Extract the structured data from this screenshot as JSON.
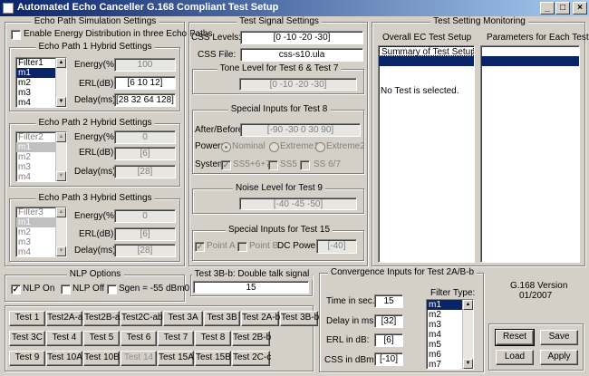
{
  "window": {
    "title": "Automated  Echo Canceller G.168 Compliant Test Setup",
    "minimize": "_",
    "maximize": "□",
    "close": "×"
  },
  "echo_sim": {
    "label": "Echo Path Simulation Settings",
    "enable_energy": "Enable Energy Distribution in three Echo Paths",
    "paths": [
      {
        "label": "Echo Path 1 Hybrid Settings",
        "list": [
          "Filter1",
          "m1",
          "m2",
          "m3",
          "m4"
        ],
        "energy_label": "Energy(%):",
        "energy": "100",
        "erl_label": "ERL(dB):",
        "erl": "[6 10 12]",
        "delay_label": "Delay(ms):",
        "delay": "[28 32 64 128]"
      },
      {
        "label": "Echo Path 2 Hybrid Settings",
        "list": [
          "Filter2",
          "m1",
          "m2",
          "m3",
          "m4"
        ],
        "energy_label": "Energy(%):",
        "energy": "0",
        "erl_label": "ERL(dB):",
        "erl": "[6]",
        "delay_label": "Delay(ms):",
        "delay": "[28]"
      },
      {
        "label": "Echo Path 3 Hybrid Settings",
        "list": [
          "Filter3",
          "m1",
          "m2",
          "m3",
          "m4"
        ],
        "energy_label": "Energy(%):",
        "energy": "0",
        "erl_label": "ERL(dB):",
        "erl": "[6]",
        "delay_label": "Delay(ms):",
        "delay": "[28]"
      }
    ]
  },
  "signal": {
    "label": "Test Signal Settings",
    "css_levels_label": "CSS Levels:",
    "css_levels": "[0 -10 -20 -30]",
    "css_file_label": "CSS File:",
    "css_file": "css-s10.ula",
    "tone_label": "Tone Level for Test 6 & Test 7",
    "tone": "[0 -10 -20 -30]",
    "special8_label": "Special Inputs for Test 8",
    "after_before_label": "After/Before:",
    "after_before": "[-90 -30 0 30 90]",
    "power_label": "Power:",
    "power_options": [
      "Nominal",
      "Extreme1",
      "Extreme2"
    ],
    "system_label": "System:",
    "system_options": [
      "SS5+6+7",
      "SS5",
      "SS 6/7"
    ],
    "noise_label": "Noise Level for Test 9",
    "noise": "[-40 -45 -50]",
    "special15_label": "Special Inputs for Test 15",
    "point_a": "Point A",
    "point_b": "Point B",
    "dc_power_label": "DC Power:",
    "dc_power": "[-40]"
  },
  "monitor": {
    "label": "Test Setting Monitoring",
    "overall_label": "Overall EC Test Setup",
    "params_label": "Parameters for Each Test",
    "overall_items": [
      "Summary of Test Setup"
    ],
    "no_test": "No Test is selected."
  },
  "nlp": {
    "label": "NLP Options",
    "on": "NLP On",
    "off": "NLP Off",
    "sgen": "Sgen = -55 dBm0"
  },
  "test3b": {
    "label": "Test 3B-b: Double talk signal",
    "value": "15"
  },
  "tests": [
    [
      "Test 1",
      "Test2A-a",
      "Test2B-a",
      "Test2C-ab",
      "Test 3A",
      "Test 3B",
      "Test 2A-b",
      "Test 3B-b"
    ],
    [
      "Test 3C",
      "Test 4",
      "Test 5",
      "Test 6",
      "Test 7",
      "Test 8",
      "Test 2B-b"
    ],
    [
      "Test 9",
      "Test 10A",
      "Test 10B",
      "Test 14",
      "Test 15A",
      "Test 15B",
      "Test 2C-c"
    ]
  ],
  "convergence": {
    "label": "Convergence Inputs for Test 2A/B-b",
    "time_label": "Time in sec.",
    "time": "15",
    "delay_label": "Delay in ms:",
    "delay": "[32]",
    "erl_label": "ERL in dB:",
    "erl": "[6]",
    "css_label": "CSS in dBm0:",
    "css": "[-10]",
    "filter_label": "Filter Type:",
    "filters": [
      "m1",
      "m2",
      "m3",
      "m4",
      "m5",
      "m6",
      "m7"
    ]
  },
  "version": {
    "line1": "G.168 Version",
    "line2": "01/2007"
  },
  "actions": {
    "reset": "Reset",
    "save": "Save",
    "load": "Load",
    "apply": "Apply"
  }
}
